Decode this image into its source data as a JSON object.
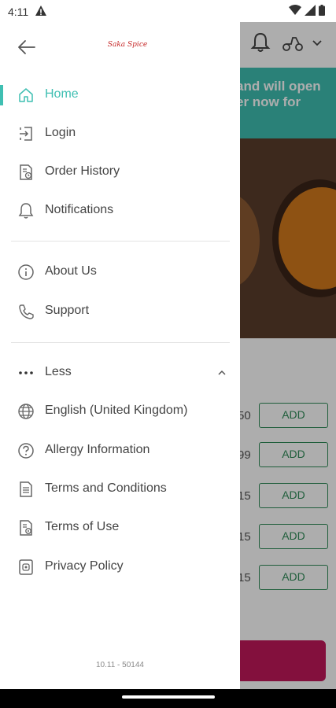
{
  "status_bar": {
    "time": "4:11"
  },
  "drawer": {
    "logo_text": "Saka Spice",
    "menu_primary": [
      {
        "label": "Home",
        "icon": "home-icon",
        "active": true
      },
      {
        "label": "Login",
        "icon": "login-icon"
      },
      {
        "label": "Order History",
        "icon": "order-history-icon"
      },
      {
        "label": "Notifications",
        "icon": "bell-icon"
      }
    ],
    "menu_secondary": [
      {
        "label": "About Us",
        "icon": "info-icon"
      },
      {
        "label": "Support",
        "icon": "phone-icon"
      }
    ],
    "less_label": "Less",
    "menu_more": [
      {
        "label": "English (United Kingdom)",
        "icon": "globe-icon"
      },
      {
        "label": "Allergy Information",
        "icon": "question-icon"
      },
      {
        "label": "Terms and Conditions",
        "icon": "document-icon"
      },
      {
        "label": "Terms of Use",
        "icon": "document-settings-icon"
      },
      {
        "label": "Privacy Policy",
        "icon": "privacy-icon"
      }
    ],
    "version": "10.11 - 50144"
  },
  "background": {
    "banner_line1": "and will open",
    "banner_line2": "er now for",
    "prices": [
      "50",
      "99",
      "15",
      "15",
      "15"
    ],
    "add_label": "ADD"
  },
  "colors": {
    "accent": "#3fbfb2",
    "add_green": "#2e8b57",
    "cta": "#c2185b"
  }
}
